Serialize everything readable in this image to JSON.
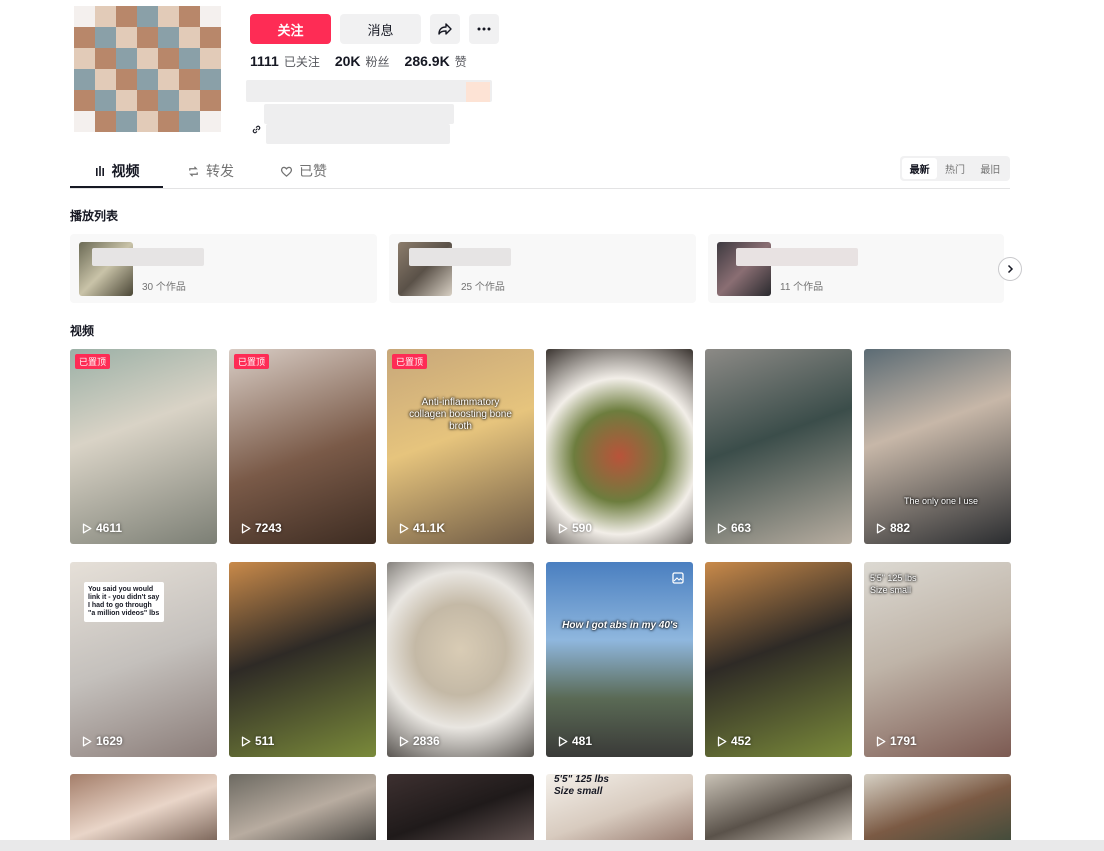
{
  "profile": {
    "follow_label": "关注",
    "message_label": "消息",
    "stats": [
      {
        "value": "1111",
        "label": "已关注"
      },
      {
        "value": "20K",
        "label": "粉丝"
      },
      {
        "value": "286.9K",
        "label": "赞"
      }
    ]
  },
  "tabs": [
    {
      "label": "视频",
      "icon": "bars-icon",
      "active": true
    },
    {
      "label": "转发",
      "icon": "repost-icon",
      "active": false
    },
    {
      "label": "已赞",
      "icon": "heart-icon",
      "active": false
    }
  ],
  "sort": [
    "最新",
    "热门",
    "最旧"
  ],
  "playlists_title": "播放列表",
  "playlists": [
    {
      "count": "30 个作品"
    },
    {
      "count": "25 个作品"
    },
    {
      "count": "11 个作品"
    }
  ],
  "videos_title": "视频",
  "pin_label": "已置顶",
  "videos": [
    {
      "views": "4611",
      "pinned": true
    },
    {
      "views": "7243",
      "pinned": true
    },
    {
      "views": "41.1K",
      "pinned": true,
      "overlay": "Anti-inflammatory collagen boosting bone broth"
    },
    {
      "views": "590"
    },
    {
      "views": "663"
    },
    {
      "views": "882",
      "overlay": "The only one I use"
    },
    {
      "views": "1629",
      "caption": "You said you would link it - you didn't say I had to go through \"a million videos\" lbs"
    },
    {
      "views": "511"
    },
    {
      "views": "2836"
    },
    {
      "views": "481",
      "overlay": "How I got abs in my 40's"
    },
    {
      "views": "452"
    },
    {
      "views": "1791",
      "overlay": "5'5\" 125 lbs Size small"
    },
    {},
    {},
    {},
    {
      "overlay": "5'5\" 125 lbs Size small"
    },
    {},
    {}
  ],
  "colors": {
    "brand": "#fe2c55",
    "text": "#161823",
    "muted": "#737373"
  }
}
